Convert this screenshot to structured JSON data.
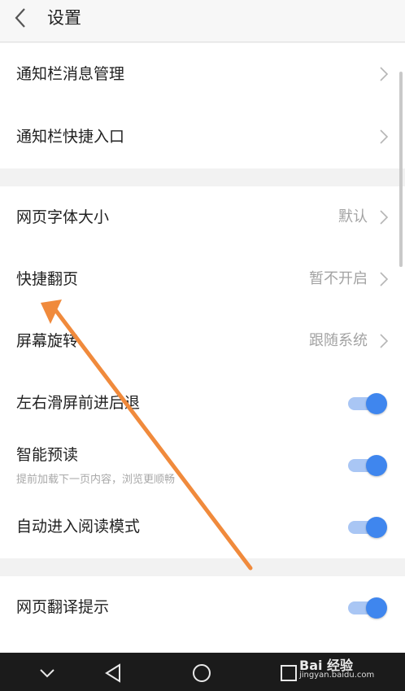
{
  "header": {
    "title": "设置",
    "back_icon": "chevron-left-icon"
  },
  "groups": [
    {
      "items": [
        {
          "label": "通知栏消息管理",
          "type": "link"
        },
        {
          "label": "通知栏快捷入口",
          "type": "link"
        }
      ]
    },
    {
      "items": [
        {
          "label": "网页字体大小",
          "value": "默认",
          "type": "link"
        },
        {
          "label": "快捷翻页",
          "value": "暂不开启",
          "type": "link"
        },
        {
          "label": "屏幕旋转",
          "value": "跟随系统",
          "type": "link"
        },
        {
          "label": "左右滑屏前进后退",
          "type": "toggle",
          "on": true
        },
        {
          "label": "智能预读",
          "subtitle": "提前加载下一页内容，浏览更顺畅",
          "type": "toggle",
          "on": true
        },
        {
          "label": "自动进入阅读模式",
          "type": "toggle",
          "on": true
        }
      ]
    },
    {
      "items": [
        {
          "label": "网页翻译提示",
          "type": "toggle",
          "on": true
        }
      ]
    }
  ],
  "navbar": {
    "buttons": [
      "chevron-down-icon",
      "back-triangle-icon",
      "home-circle-icon",
      "recents-square-icon"
    ]
  },
  "watermark": {
    "text": "Bai 经验",
    "url": "jingyan.baidu.com"
  },
  "annotation": {
    "arrow_color": "#f08a3c"
  },
  "colors": {
    "accent": "#3f86ee",
    "track": "#a9c6f4",
    "secondary_text": "#a3a3a3"
  }
}
